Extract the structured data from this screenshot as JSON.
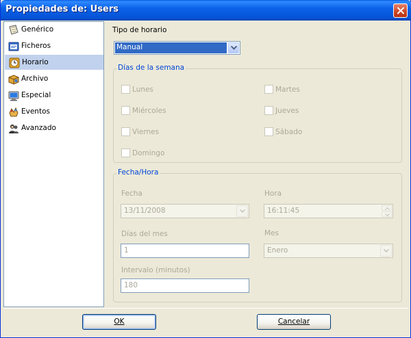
{
  "window": {
    "title": "Propiedades de: Users"
  },
  "nav": {
    "items": [
      {
        "label": "Genérico",
        "icon": "generic-document-icon",
        "selected": false
      },
      {
        "label": "Ficheros",
        "icon": "files-icon",
        "selected": false
      },
      {
        "label": "Horario",
        "icon": "clock-icon",
        "selected": true
      },
      {
        "label": "Archivo",
        "icon": "archive-icon",
        "selected": false
      },
      {
        "label": "Especial",
        "icon": "monitor-icon",
        "selected": false
      },
      {
        "label": "Eventos",
        "icon": "events-icon",
        "selected": false
      },
      {
        "label": "Avanzado",
        "icon": "users-icon",
        "selected": false
      }
    ]
  },
  "schedule": {
    "type_label": "Tipo de horario",
    "type_value": "Manual"
  },
  "weekdays": {
    "title": "Días de la semana",
    "days": [
      {
        "label": "Lunes",
        "checked": false
      },
      {
        "label": "Martes",
        "checked": false
      },
      {
        "label": "Miércoles",
        "checked": false
      },
      {
        "label": "Jueves",
        "checked": false
      },
      {
        "label": "Viernes",
        "checked": false
      },
      {
        "label": "Sábado",
        "checked": false
      },
      {
        "label": "Domingo",
        "checked": false
      }
    ]
  },
  "datetime": {
    "title": "Fecha/Hora",
    "date_label": "Fecha",
    "date_value": "13/11/2008",
    "time_label": "Hora",
    "time_value": "16:11:45",
    "month_days_label": "Días del mes",
    "month_days_value": "1",
    "month_label": "Mes",
    "month_value": "Enero",
    "interval_label": "Intervalo (minutos)",
    "interval_value": "180"
  },
  "buttons": {
    "ok": "OK",
    "cancel": "Cancelar"
  },
  "colors": {
    "titlebar": "#0a62e8",
    "selection": "#c1d2ee",
    "group_title": "#0046d5",
    "disabled_text": "#aca899"
  }
}
